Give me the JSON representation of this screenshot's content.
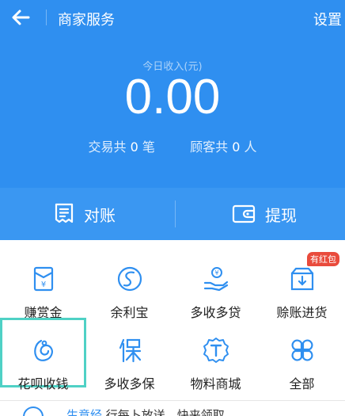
{
  "header": {
    "title": "商家服务",
    "settings_label": "设置",
    "income_label": "今日收入(元)",
    "income_value": "0.00",
    "stats": {
      "transactions_prefix": "交易共",
      "transactions_count": "0",
      "transactions_unit": "笔",
      "customers_prefix": "顾客共",
      "customers_count": "0",
      "customers_unit": "人"
    }
  },
  "actions": [
    {
      "label": "对账",
      "icon": "reconcile-icon"
    },
    {
      "label": "提现",
      "icon": "wallet-icon"
    }
  ],
  "grid": [
    {
      "label": "赚赏金",
      "icon": "reward-envelope-icon"
    },
    {
      "label": "余利宝",
      "icon": "yulibao-icon"
    },
    {
      "label": "多收多贷",
      "icon": "loan-hand-icon"
    },
    {
      "label": "赊账进货",
      "icon": "credit-purchase-icon",
      "badge": "有红包"
    },
    {
      "label": "花呗收钱",
      "icon": "huabei-icon",
      "selected": true
    },
    {
      "label": "多收多保",
      "icon": "insurance-icon"
    },
    {
      "label": "物料商城",
      "icon": "material-store-icon"
    },
    {
      "label": "全部",
      "icon": "all-apps-icon"
    }
  ],
  "bottom_strip": {
    "highlight": "生意经",
    "text": "行每卜放送，快来领取"
  },
  "colors": {
    "primary": "#2f8ff0",
    "accent": "#2f8ff0",
    "badge": "#e94b3c",
    "selection": "#4fd1c5"
  }
}
